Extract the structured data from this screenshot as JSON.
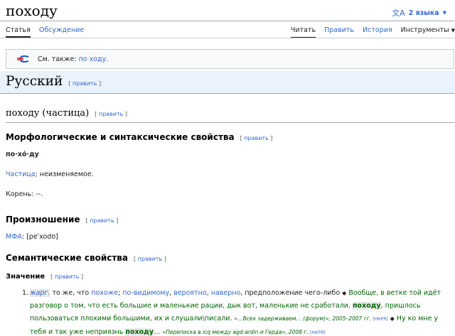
{
  "page": {
    "title": "походу",
    "languages_label": "2 языка"
  },
  "tabs": {
    "article": "Статья",
    "discussion": "Обсуждение",
    "read": "Читать",
    "edit": "Править",
    "history": "История",
    "tools": "Инструменты"
  },
  "see_also": {
    "prefix": "См. также:",
    "link": "по ходу."
  },
  "edit_link": "править",
  "language_section": {
    "title": "Русский"
  },
  "word_heading": "походу (частица)",
  "morph": {
    "heading": "Морфологические и синтаксические свойства",
    "syllables": "по·хо́·ду",
    "pos_link": "Частица",
    "pos_rest": "; неизменяемое.",
    "root": "Корень: --."
  },
  "pron": {
    "heading": "Произношение",
    "ipa_label": "МФА",
    "ipa_value": ": [pɐˈxodʊ]"
  },
  "semantic": {
    "heading": "Семантические свойства",
    "meaning_heading": "Значение",
    "def_number": "1.",
    "label_slang": "жарг.",
    "def_text1": " то же, что ",
    "syn1": "похоже",
    "sep1": "; ",
    "syn2": "по-видимому",
    "sep2": ", ",
    "syn3": "вероятно",
    "sep3": ", ",
    "syn4": "наверно",
    "def_text2": ", предположение чего-либо ",
    "diamond": "◆",
    "quote1a": " Вообще, в ветке той идёт разговор о том, что есть большие и маленькие рации, дык вот, маленькие не сработали, ",
    "quote1_word": "походу",
    "quote1b": ", пришлось пользоваться плохими большими, их и слушали\\писали. ",
    "src1": "«…Всех задерживаем… (форум)», 2005–2007 гг.",
    "src1_tag": "[НКРЯ]",
    "quote2a": " Ну ко мне у тебя и так уже неприязнь ",
    "quote2_word": "походу",
    "quote2b": "… ",
    "src2": "«Переписка в icq между agd-ardin и Герда», 2008 г.",
    "src2_tag": "[НКРЯ]"
  },
  "colors": {
    "link": "#3366cc",
    "quote": "#006400",
    "header_bg": "#eaf3fd"
  }
}
